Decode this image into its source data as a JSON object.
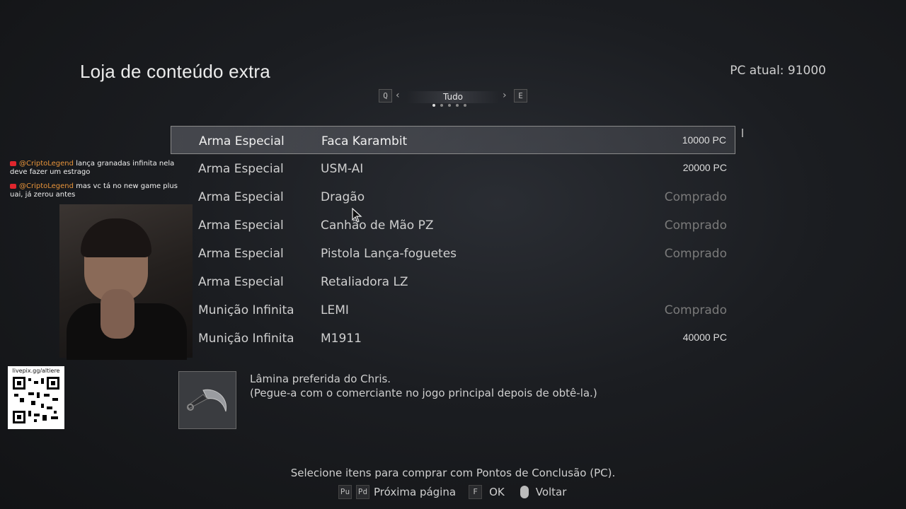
{
  "header": {
    "title": "Loja de conteúdo extra",
    "pc_label": "PC atual: 91000"
  },
  "filter": {
    "prev_key": "Q",
    "next_key": "E",
    "current": "Tudo",
    "pages": 5,
    "active_page": 1
  },
  "items": [
    {
      "category": "Arma Especial",
      "name": "Faca Karambit",
      "price": "10000 PC",
      "selected": true
    },
    {
      "category": "Arma Especial",
      "name": "USM-AI",
      "price": "20000 PC"
    },
    {
      "category": "Arma Especial",
      "name": "Dragão",
      "price": "Comprado"
    },
    {
      "category": "Arma Especial",
      "name": "Canhão de Mão PZ",
      "price": "Comprado"
    },
    {
      "category": "Arma Especial",
      "name": "Pistola Lança-foguetes",
      "price": "Comprado"
    },
    {
      "category": "Arma Especial",
      "name": "Retaliadora LZ",
      "price": ""
    },
    {
      "category": "Munição Infinita",
      "name": "LEMI",
      "price": "Comprado"
    },
    {
      "category": "Munição Infinita",
      "name": "M1911",
      "price": "40000 PC"
    }
  ],
  "detail": {
    "line1": "Lâmina preferida do Chris.",
    "line2": "(Pegue-a com o comerciante no jogo principal depois de obtê-la.)",
    "icon": "karambit-knife-icon"
  },
  "footer": {
    "hint": "Selecione itens para comprar com Pontos de Conclusão (PC).",
    "key_pu": "Pu",
    "key_pd": "Pd",
    "next_page": "Próxima página",
    "key_f": "F",
    "ok": "OK",
    "back": "Voltar"
  },
  "overlay": {
    "chat": [
      {
        "user": "@CriptoLegend",
        "text": "lança granadas infinita nela deve fazer um estrago"
      },
      {
        "user": "@CriptoLegend",
        "text": "mas vc tá no new game plus uai, já zerou antes"
      }
    ],
    "qr_label": "livepix.gg/altiere"
  }
}
